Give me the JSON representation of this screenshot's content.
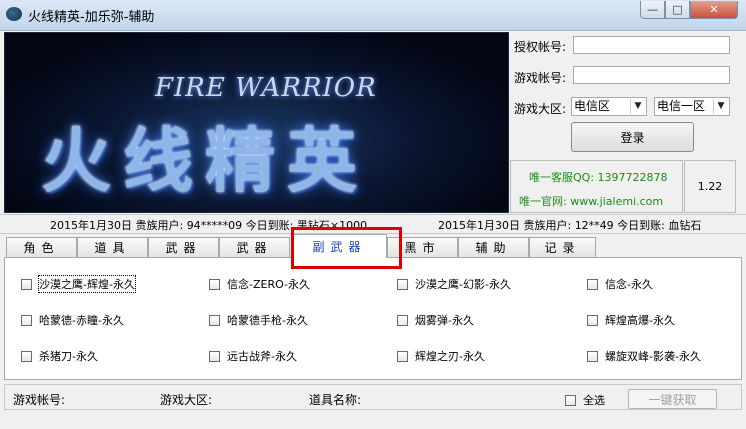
{
  "window": {
    "title": "火线精英-加乐弥-辅助",
    "min_glyph": "—",
    "max_glyph": "□",
    "close_glyph": "✕"
  },
  "banner": {
    "subtitle": "FIRE WARRIOR",
    "main_text": "火线精英"
  },
  "login": {
    "account_label": "授权帐号:",
    "account_value": "",
    "game_account_label": "游戏帐号:",
    "game_account_value": "",
    "region_label": "游戏大区:",
    "region_select_1": "电信区",
    "region_select_2": "电信一区",
    "login_button": "登录"
  },
  "info": {
    "qq_line": "唯一客服QQ: 1397722878",
    "site_line": "唯一官网: www.jialemi.com",
    "version": "1.22"
  },
  "marquee": {
    "text1": "2015年1月30日   贵族用户: 94*****09   今日到账: 黑钻石×1000",
    "text2": "2015年1月30日   贵族用户: 12**49   今日到账: 血钻石"
  },
  "tabs": [
    {
      "label": "角色"
    },
    {
      "label": "道具"
    },
    {
      "label": "武器"
    },
    {
      "label": "武器"
    },
    {
      "label": "副武器"
    },
    {
      "label": "黑市"
    },
    {
      "label": "辅助"
    },
    {
      "label": "记录"
    }
  ],
  "items": [
    {
      "label": "沙漠之鹰-辉煌-永久"
    },
    {
      "label": "信念-ZERO-永久"
    },
    {
      "label": "沙漠之鹰-幻影-永久"
    },
    {
      "label": "信念-永久"
    },
    {
      "label": "哈蒙德-赤瞳-永久"
    },
    {
      "label": "哈蒙德手枪-永久"
    },
    {
      "label": "烟雾弹-永久"
    },
    {
      "label": "辉煌高爆-永久"
    },
    {
      "label": "杀猪刀-永久"
    },
    {
      "label": "远古战斧-永久"
    },
    {
      "label": "辉煌之刃-永久"
    },
    {
      "label": "螺旋双峰-影袭-永久"
    }
  ],
  "footer": {
    "game_account_label": "游戏帐号:",
    "game_region_label": "游戏大区:",
    "item_name_label": "道具名称:",
    "select_all_label": "全选",
    "fetch_button": "一键获取"
  },
  "colors": {
    "highlight": "#e00000",
    "active_tab_text": "#1a3fbf",
    "info_text": "#1a8a1a"
  }
}
